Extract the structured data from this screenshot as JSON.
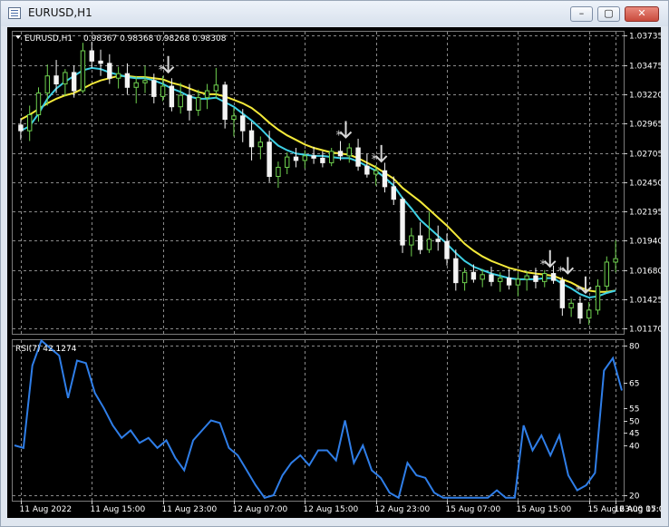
{
  "window": {
    "title": "EURUSD,H1",
    "buttons": {
      "minimize": "–",
      "maximize": "▢",
      "close": "✕"
    }
  },
  "main_chart": {
    "symbol_label": "EURUSD,H1",
    "ohlc_text": "0.98367 0.98368 0.98268 0.98308",
    "price_labels": [
      "1.03735",
      "1.03475",
      "1.03220",
      "1.02965",
      "1.02705",
      "1.02450",
      "1.02195",
      "1.01940",
      "1.01680",
      "1.01425",
      "1.01170"
    ],
    "colors": {
      "background": "#000000",
      "grid": "#8a8a8a",
      "bull_candle": "#6fd14f",
      "bear_candle": "#f4f4f4",
      "fast_ma": "#3ed0e5",
      "slow_ma": "#f4ea3a",
      "arrow": "#d8d8d8"
    },
    "markers": [
      {
        "type": "sell-arrow",
        "near": "12 Aug 07:00"
      },
      {
        "type": "sell-arrow",
        "near": "12 Aug 23:00"
      },
      {
        "type": "sell-arrow",
        "near": "15 Aug 07:00"
      },
      {
        "type": "sell-arrow",
        "near": "16 Aug 07:00"
      },
      {
        "type": "sell-arrow",
        "near": "16 Aug 07:00"
      },
      {
        "type": "sell-arrow",
        "near": "16 Aug 15:00"
      }
    ]
  },
  "rsi": {
    "label": "RSI(7) 42.1274",
    "levels": [
      "80",
      "65",
      "55",
      "50",
      "45",
      "40",
      "20"
    ]
  },
  "time_labels": [
    "11 Aug 2022",
    "11 Aug 15:00",
    "11 Aug 23:00",
    "12 Aug 07:00",
    "12 Aug 15:00",
    "12 Aug 23:00",
    "15 Aug 07:00",
    "15 Aug 15:00",
    "15 Aug 23:00",
    "16 Aug 07:00",
    "16 Aug 15:00"
  ],
  "chart_data": {
    "type": "candlestick",
    "series": [
      {
        "name": "EURUSD,H1",
        "ohlc": [
          [
            1.0295,
            1.0301,
            1.0282,
            1.029
          ],
          [
            1.029,
            1.0312,
            1.0281,
            1.0304
          ],
          [
            1.0304,
            1.0328,
            1.0298,
            1.0323
          ],
          [
            1.0323,
            1.0348,
            1.0312,
            1.0338
          ],
          [
            1.0338,
            1.0352,
            1.0323,
            1.0331
          ],
          [
            1.0331,
            1.0344,
            1.032,
            1.0341
          ],
          [
            1.0341,
            1.0347,
            1.0319,
            1.0325
          ],
          [
            1.0325,
            1.0367,
            1.0323,
            1.036
          ],
          [
            1.036,
            1.0368,
            1.0345,
            1.0351
          ],
          [
            1.0351,
            1.0361,
            1.0338,
            1.0349
          ],
          [
            1.0349,
            1.0357,
            1.0331,
            1.0336
          ],
          [
            1.0336,
            1.0346,
            1.0327,
            1.034
          ],
          [
            1.034,
            1.0349,
            1.0322,
            1.0328
          ],
          [
            1.0328,
            1.0338,
            1.0314,
            1.0332
          ],
          [
            1.0332,
            1.0347,
            1.0323,
            1.0334
          ],
          [
            1.0334,
            1.034,
            1.0314,
            1.032
          ],
          [
            1.032,
            1.0338,
            1.0316,
            1.0329
          ],
          [
            1.0329,
            1.0336,
            1.0307,
            1.0311
          ],
          [
            1.0311,
            1.0332,
            1.0305,
            1.0321
          ],
          [
            1.0321,
            1.0331,
            1.0299,
            1.0308
          ],
          [
            1.0308,
            1.0326,
            1.0303,
            1.0319
          ],
          [
            1.0319,
            1.0331,
            1.0309,
            1.0325
          ],
          [
            1.0325,
            1.0345,
            1.0318,
            1.033
          ],
          [
            1.033,
            1.0333,
            1.0292,
            1.03
          ],
          [
            1.03,
            1.031,
            1.0285,
            1.0303
          ],
          [
            1.0303,
            1.0309,
            1.028,
            1.029
          ],
          [
            1.029,
            1.0298,
            1.0264,
            1.0276
          ],
          [
            1.0276,
            1.0285,
            1.0265,
            1.028
          ],
          [
            1.028,
            1.029,
            1.0245,
            1.025
          ],
          [
            1.025,
            1.0263,
            1.024,
            1.0258
          ],
          [
            1.0258,
            1.0271,
            1.0252,
            1.0267
          ],
          [
            1.0267,
            1.0275,
            1.0258,
            1.0264
          ],
          [
            1.0264,
            1.0273,
            1.0257,
            1.0268
          ],
          [
            1.0268,
            1.0276,
            1.0261,
            1.0266
          ],
          [
            1.0266,
            1.0272,
            1.0258,
            1.0262
          ],
          [
            1.0262,
            1.0275,
            1.0259,
            1.0272
          ],
          [
            1.0272,
            1.0281,
            1.0264,
            1.0268
          ],
          [
            1.0268,
            1.0279,
            1.0262,
            1.0275
          ],
          [
            1.0275,
            1.0283,
            1.0255,
            1.0259
          ],
          [
            1.0259,
            1.027,
            1.0249,
            1.0252
          ],
          [
            1.0252,
            1.026,
            1.0242,
            1.0255
          ],
          [
            1.0255,
            1.0262,
            1.0236,
            1.0241
          ],
          [
            1.0241,
            1.025,
            1.0225,
            1.023
          ],
          [
            1.023,
            1.0232,
            1.0183,
            1.019
          ],
          [
            1.019,
            1.0205,
            1.018,
            1.0198
          ],
          [
            1.0198,
            1.021,
            1.0182,
            1.0186
          ],
          [
            1.0186,
            1.0219,
            1.0183,
            1.0195
          ],
          [
            1.0195,
            1.0207,
            1.0185,
            1.0193
          ],
          [
            1.0193,
            1.02,
            1.0172,
            1.0178
          ],
          [
            1.0178,
            1.0186,
            1.015,
            1.0157
          ],
          [
            1.0157,
            1.017,
            1.015,
            1.0166
          ],
          [
            1.0166,
            1.0173,
            1.0157,
            1.016
          ],
          [
            1.016,
            1.0169,
            1.0153,
            1.0164
          ],
          [
            1.0164,
            1.0171,
            1.0154,
            1.0158
          ],
          [
            1.0158,
            1.0166,
            1.0149,
            1.0161
          ],
          [
            1.0161,
            1.0169,
            1.0151,
            1.0155
          ],
          [
            1.0155,
            1.0165,
            1.0145,
            1.016
          ],
          [
            1.016,
            1.0167,
            1.015,
            1.0163
          ],
          [
            1.0163,
            1.017,
            1.0152,
            1.0158
          ],
          [
            1.0158,
            1.0168,
            1.0153,
            1.0165
          ],
          [
            1.0165,
            1.0172,
            1.0156,
            1.0159
          ],
          [
            1.0159,
            1.0162,
            1.0128,
            1.0135
          ],
          [
            1.0135,
            1.0143,
            1.0127,
            1.0139
          ],
          [
            1.0139,
            1.0145,
            1.0121,
            1.0126
          ],
          [
            1.0126,
            1.014,
            1.012,
            1.0133
          ],
          [
            1.0133,
            1.016,
            1.0129,
            1.0154
          ],
          [
            1.0154,
            1.018,
            1.0149,
            1.0175
          ],
          [
            1.0175,
            1.0194,
            1.0166,
            1.0178
          ]
        ]
      },
      {
        "name": "fast MA",
        "values": [
          1.029,
          1.0294,
          1.0305,
          1.0318,
          1.0327,
          1.0333,
          1.0338,
          1.0343,
          1.0345,
          1.0344,
          1.0341,
          1.0339,
          1.0337,
          1.0336,
          1.0336,
          1.0334,
          1.0331,
          1.0327,
          1.0324,
          1.032,
          1.0318,
          1.0318,
          1.0319,
          1.0315,
          1.0311,
          1.0305,
          1.0299,
          1.0292,
          1.0284,
          1.0277,
          1.0273,
          1.027,
          1.0269,
          1.0268,
          1.0268,
          1.0267,
          1.0266,
          1.0266,
          1.0263,
          1.0259,
          1.0255,
          1.0249,
          1.0242,
          1.0231,
          1.0222,
          1.0212,
          1.0205,
          1.0198,
          1.0191,
          1.0183,
          1.0176,
          1.0171,
          1.0168,
          1.0165,
          1.0163,
          1.0161,
          1.016,
          1.016,
          1.016,
          1.0161,
          1.0161,
          1.0156,
          1.0152,
          1.0147,
          1.0144,
          1.0145,
          1.0148,
          1.015
        ]
      },
      {
        "name": "slow MA",
        "values": [
          1.03,
          1.0304,
          1.0309,
          1.0314,
          1.0318,
          1.0321,
          1.0323,
          1.0327,
          1.0331,
          1.0334,
          1.0336,
          1.0338,
          1.0338,
          1.0337,
          1.0337,
          1.0336,
          1.0335,
          1.0332,
          1.033,
          1.0327,
          1.0324,
          1.0322,
          1.0322,
          1.032,
          1.0317,
          1.0314,
          1.031,
          1.0304,
          1.0297,
          1.0291,
          1.0286,
          1.0282,
          1.0278,
          1.0275,
          1.0273,
          1.0271,
          1.027,
          1.0269,
          1.0266,
          1.0262,
          1.0258,
          1.0253,
          1.0248,
          1.024,
          1.0234,
          1.0228,
          1.0221,
          1.0214,
          1.0207,
          1.0199,
          1.0191,
          1.0185,
          1.018,
          1.0176,
          1.0173,
          1.017,
          1.0168,
          1.0166,
          1.0165,
          1.0164,
          1.0163,
          1.016,
          1.0157,
          1.0153,
          1.015,
          1.0149,
          1.0149,
          1.015
        ]
      },
      {
        "name": "RSI(7)",
        "values": [
          40,
          39,
          72,
          82,
          79,
          76,
          59,
          74,
          73,
          61,
          55,
          48,
          43,
          46,
          41,
          43,
          39,
          42,
          35,
          30,
          42,
          46,
          50,
          49,
          39,
          36,
          30,
          24,
          14,
          20,
          28,
          33,
          36,
          32,
          38,
          38,
          34,
          50,
          33,
          40,
          30,
          27,
          21,
          18,
          33,
          28,
          27,
          21,
          15,
          13,
          15,
          15,
          10,
          18,
          22,
          19,
          9,
          48,
          38,
          44,
          36,
          44,
          28,
          22,
          24,
          29,
          70,
          75,
          62
        ]
      }
    ],
    "ylim": [
      1.0117,
      1.03735
    ],
    "rsi_ylim": [
      20,
      80
    ],
    "grid": true
  }
}
